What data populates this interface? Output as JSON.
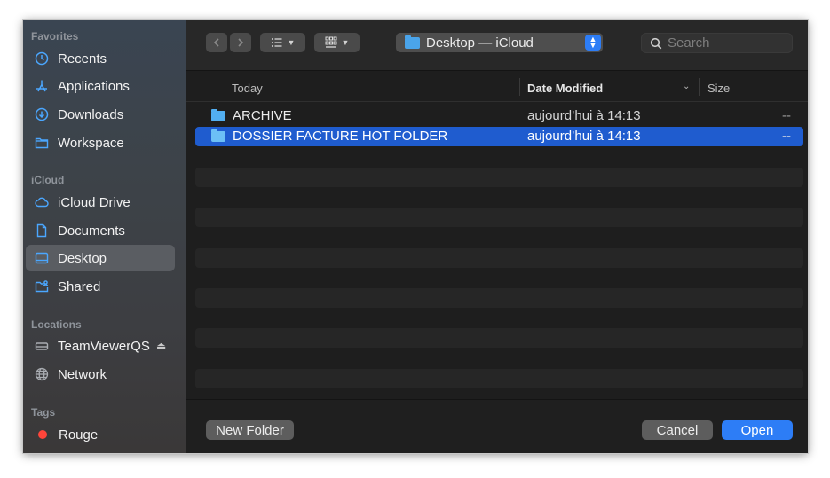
{
  "sidebar": {
    "favorites_title": "Favorites",
    "favorites": [
      {
        "label": "Recents",
        "icon": "clock-icon"
      },
      {
        "label": "Applications",
        "icon": "applications-icon"
      },
      {
        "label": "Downloads",
        "icon": "download-icon"
      },
      {
        "label": "Workspace",
        "icon": "folder-icon"
      }
    ],
    "icloud_title": "iCloud",
    "icloud": [
      {
        "label": "iCloud Drive",
        "icon": "cloud-icon"
      },
      {
        "label": "Documents",
        "icon": "document-icon"
      },
      {
        "label": "Desktop",
        "icon": "desktop-icon",
        "selected": true
      },
      {
        "label": "Shared",
        "icon": "shared-folder-icon"
      }
    ],
    "locations_title": "Locations",
    "locations": [
      {
        "label": "TeamViewerQS",
        "icon": "drive-icon",
        "eject": "⏏"
      },
      {
        "label": "Network",
        "icon": "network-icon"
      }
    ],
    "tags_title": "Tags",
    "tags": [
      {
        "label": "Rouge",
        "color": "#ff453a"
      }
    ]
  },
  "toolbar": {
    "location": "Desktop — iCloud",
    "search_placeholder": "Search"
  },
  "list": {
    "headers": {
      "name": "Today",
      "date": "Date Modified",
      "size": "Size"
    },
    "rows": [
      {
        "name": "ARCHIVE",
        "date": "aujourd’hui à 14:13",
        "size": "--",
        "selected": false
      },
      {
        "name": "DOSSIER FACTURE HOT FOLDER",
        "date": "aujourd’hui à 14:13",
        "size": "--",
        "selected": true
      }
    ]
  },
  "footer": {
    "new_folder": "New Folder",
    "cancel": "Cancel",
    "open": "Open"
  },
  "colors": {
    "accent": "#2d7df6",
    "selection": "#1f5ccf",
    "sidebar_icon": "#4ba7ff",
    "tag_red": "#ff453a"
  }
}
